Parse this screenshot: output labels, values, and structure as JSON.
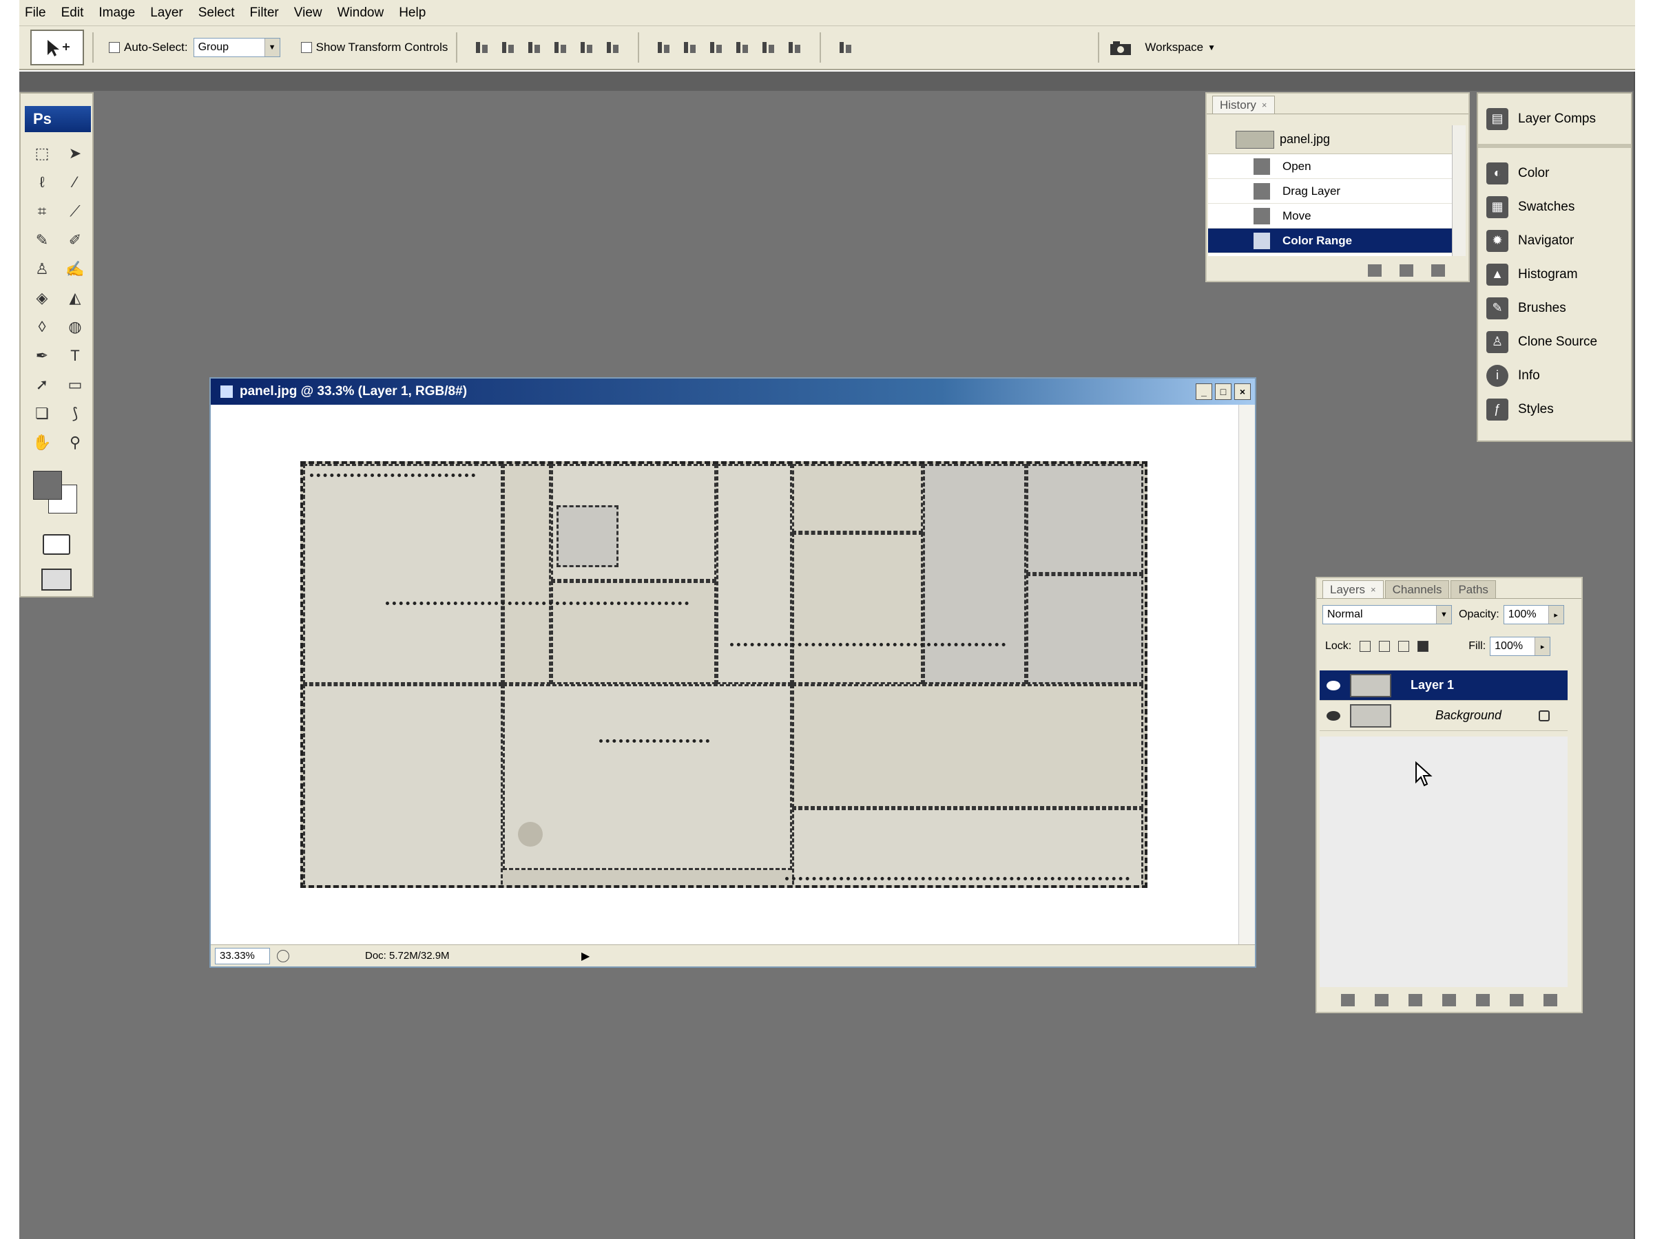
{
  "menu": [
    "File",
    "Edit",
    "Image",
    "Layer",
    "Select",
    "Filter",
    "View",
    "Window",
    "Help"
  ],
  "options": {
    "auto_select_label": "Auto-Select:",
    "auto_select_value": "Group",
    "show_transform_label": "Show Transform Controls",
    "workspace_label": "Workspace"
  },
  "toolbox": {
    "logo": "Ps",
    "tools": [
      "marquee-icon",
      "move-icon",
      "lasso-icon",
      "magic-wand-icon",
      "crop-icon",
      "slice-icon",
      "healing-brush-icon",
      "brush-icon",
      "clone-stamp-icon",
      "history-brush-icon",
      "eraser-icon",
      "paint-bucket-icon",
      "blur-icon",
      "dodge-icon",
      "pen-icon",
      "type-icon",
      "path-selection-icon",
      "shape-icon",
      "notes-icon",
      "eyedropper-icon",
      "hand-icon",
      "zoom-icon"
    ],
    "type_tool_glyph": "T",
    "foreground_color": "#6f6f6f",
    "background_color": "#ffffff"
  },
  "document": {
    "title": "panel.jpg @ 33.3% (Layer 1, RGB/8#)",
    "zoom": "33.33%",
    "doc_info": "Doc: 5.72M/32.9M",
    "min_glyph": "_",
    "max_glyph": "□",
    "close_glyph": "×"
  },
  "history": {
    "tab_label": "History",
    "tab_close": "×",
    "snapshot_label": "panel.jpg",
    "states": [
      "Open",
      "Drag Layer",
      "Move",
      "Color Range"
    ],
    "selected_state": "Color Range"
  },
  "dock": {
    "group1": [
      {
        "label": "Layer Comps",
        "icon": "layer-comps-icon"
      }
    ],
    "group2": [
      {
        "label": "Color",
        "icon": "color-icon"
      },
      {
        "label": "Swatches",
        "icon": "swatches-icon"
      },
      {
        "label": "Navigator",
        "icon": "navigator-icon"
      },
      {
        "label": "Histogram",
        "icon": "histogram-icon"
      },
      {
        "label": "Brushes",
        "icon": "brushes-icon"
      },
      {
        "label": "Clone Source",
        "icon": "clone-source-icon"
      },
      {
        "label": "Info",
        "icon": "info-icon"
      },
      {
        "label": "Styles",
        "icon": "styles-icon"
      }
    ]
  },
  "layers": {
    "tabs": [
      "Layers",
      "Channels",
      "Paths"
    ],
    "tab_close": "×",
    "blend_mode": "Normal",
    "opacity_label": "Opacity:",
    "opacity_value": "100%",
    "lock_label": "Lock:",
    "fill_label": "Fill:",
    "fill_value": "100%",
    "items": [
      {
        "name": "Layer 1",
        "selected": true,
        "locked": false
      },
      {
        "name": "Background",
        "selected": false,
        "locked": true
      }
    ]
  },
  "colors": {
    "workspace": "#737373",
    "chrome": "#ece9d8",
    "selection": "#0a246a"
  }
}
